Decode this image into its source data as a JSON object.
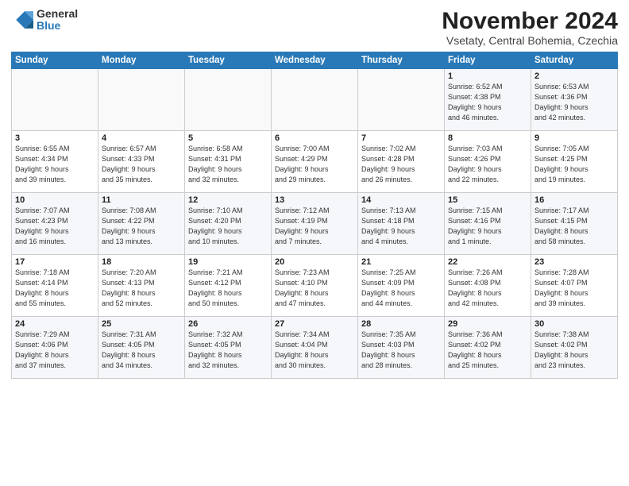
{
  "logo": {
    "general": "General",
    "blue": "Blue"
  },
  "header": {
    "month_year": "November 2024",
    "location": "Vsetaty, Central Bohemia, Czechia"
  },
  "weekdays": [
    "Sunday",
    "Monday",
    "Tuesday",
    "Wednesday",
    "Thursday",
    "Friday",
    "Saturday"
  ],
  "rows": [
    [
      {
        "day": "",
        "info": ""
      },
      {
        "day": "",
        "info": ""
      },
      {
        "day": "",
        "info": ""
      },
      {
        "day": "",
        "info": ""
      },
      {
        "day": "",
        "info": ""
      },
      {
        "day": "1",
        "info": "Sunrise: 6:52 AM\nSunset: 4:38 PM\nDaylight: 9 hours\nand 46 minutes."
      },
      {
        "day": "2",
        "info": "Sunrise: 6:53 AM\nSunset: 4:36 PM\nDaylight: 9 hours\nand 42 minutes."
      }
    ],
    [
      {
        "day": "3",
        "info": "Sunrise: 6:55 AM\nSunset: 4:34 PM\nDaylight: 9 hours\nand 39 minutes."
      },
      {
        "day": "4",
        "info": "Sunrise: 6:57 AM\nSunset: 4:33 PM\nDaylight: 9 hours\nand 35 minutes."
      },
      {
        "day": "5",
        "info": "Sunrise: 6:58 AM\nSunset: 4:31 PM\nDaylight: 9 hours\nand 32 minutes."
      },
      {
        "day": "6",
        "info": "Sunrise: 7:00 AM\nSunset: 4:29 PM\nDaylight: 9 hours\nand 29 minutes."
      },
      {
        "day": "7",
        "info": "Sunrise: 7:02 AM\nSunset: 4:28 PM\nDaylight: 9 hours\nand 26 minutes."
      },
      {
        "day": "8",
        "info": "Sunrise: 7:03 AM\nSunset: 4:26 PM\nDaylight: 9 hours\nand 22 minutes."
      },
      {
        "day": "9",
        "info": "Sunrise: 7:05 AM\nSunset: 4:25 PM\nDaylight: 9 hours\nand 19 minutes."
      }
    ],
    [
      {
        "day": "10",
        "info": "Sunrise: 7:07 AM\nSunset: 4:23 PM\nDaylight: 9 hours\nand 16 minutes."
      },
      {
        "day": "11",
        "info": "Sunrise: 7:08 AM\nSunset: 4:22 PM\nDaylight: 9 hours\nand 13 minutes."
      },
      {
        "day": "12",
        "info": "Sunrise: 7:10 AM\nSunset: 4:20 PM\nDaylight: 9 hours\nand 10 minutes."
      },
      {
        "day": "13",
        "info": "Sunrise: 7:12 AM\nSunset: 4:19 PM\nDaylight: 9 hours\nand 7 minutes."
      },
      {
        "day": "14",
        "info": "Sunrise: 7:13 AM\nSunset: 4:18 PM\nDaylight: 9 hours\nand 4 minutes."
      },
      {
        "day": "15",
        "info": "Sunrise: 7:15 AM\nSunset: 4:16 PM\nDaylight: 9 hours\nand 1 minute."
      },
      {
        "day": "16",
        "info": "Sunrise: 7:17 AM\nSunset: 4:15 PM\nDaylight: 8 hours\nand 58 minutes."
      }
    ],
    [
      {
        "day": "17",
        "info": "Sunrise: 7:18 AM\nSunset: 4:14 PM\nDaylight: 8 hours\nand 55 minutes."
      },
      {
        "day": "18",
        "info": "Sunrise: 7:20 AM\nSunset: 4:13 PM\nDaylight: 8 hours\nand 52 minutes."
      },
      {
        "day": "19",
        "info": "Sunrise: 7:21 AM\nSunset: 4:12 PM\nDaylight: 8 hours\nand 50 minutes."
      },
      {
        "day": "20",
        "info": "Sunrise: 7:23 AM\nSunset: 4:10 PM\nDaylight: 8 hours\nand 47 minutes."
      },
      {
        "day": "21",
        "info": "Sunrise: 7:25 AM\nSunset: 4:09 PM\nDaylight: 8 hours\nand 44 minutes."
      },
      {
        "day": "22",
        "info": "Sunrise: 7:26 AM\nSunset: 4:08 PM\nDaylight: 8 hours\nand 42 minutes."
      },
      {
        "day": "23",
        "info": "Sunrise: 7:28 AM\nSunset: 4:07 PM\nDaylight: 8 hours\nand 39 minutes."
      }
    ],
    [
      {
        "day": "24",
        "info": "Sunrise: 7:29 AM\nSunset: 4:06 PM\nDaylight: 8 hours\nand 37 minutes."
      },
      {
        "day": "25",
        "info": "Sunrise: 7:31 AM\nSunset: 4:05 PM\nDaylight: 8 hours\nand 34 minutes."
      },
      {
        "day": "26",
        "info": "Sunrise: 7:32 AM\nSunset: 4:05 PM\nDaylight: 8 hours\nand 32 minutes."
      },
      {
        "day": "27",
        "info": "Sunrise: 7:34 AM\nSunset: 4:04 PM\nDaylight: 8 hours\nand 30 minutes."
      },
      {
        "day": "28",
        "info": "Sunrise: 7:35 AM\nSunset: 4:03 PM\nDaylight: 8 hours\nand 28 minutes."
      },
      {
        "day": "29",
        "info": "Sunrise: 7:36 AM\nSunset: 4:02 PM\nDaylight: 8 hours\nand 25 minutes."
      },
      {
        "day": "30",
        "info": "Sunrise: 7:38 AM\nSunset: 4:02 PM\nDaylight: 8 hours\nand 23 minutes."
      }
    ]
  ]
}
